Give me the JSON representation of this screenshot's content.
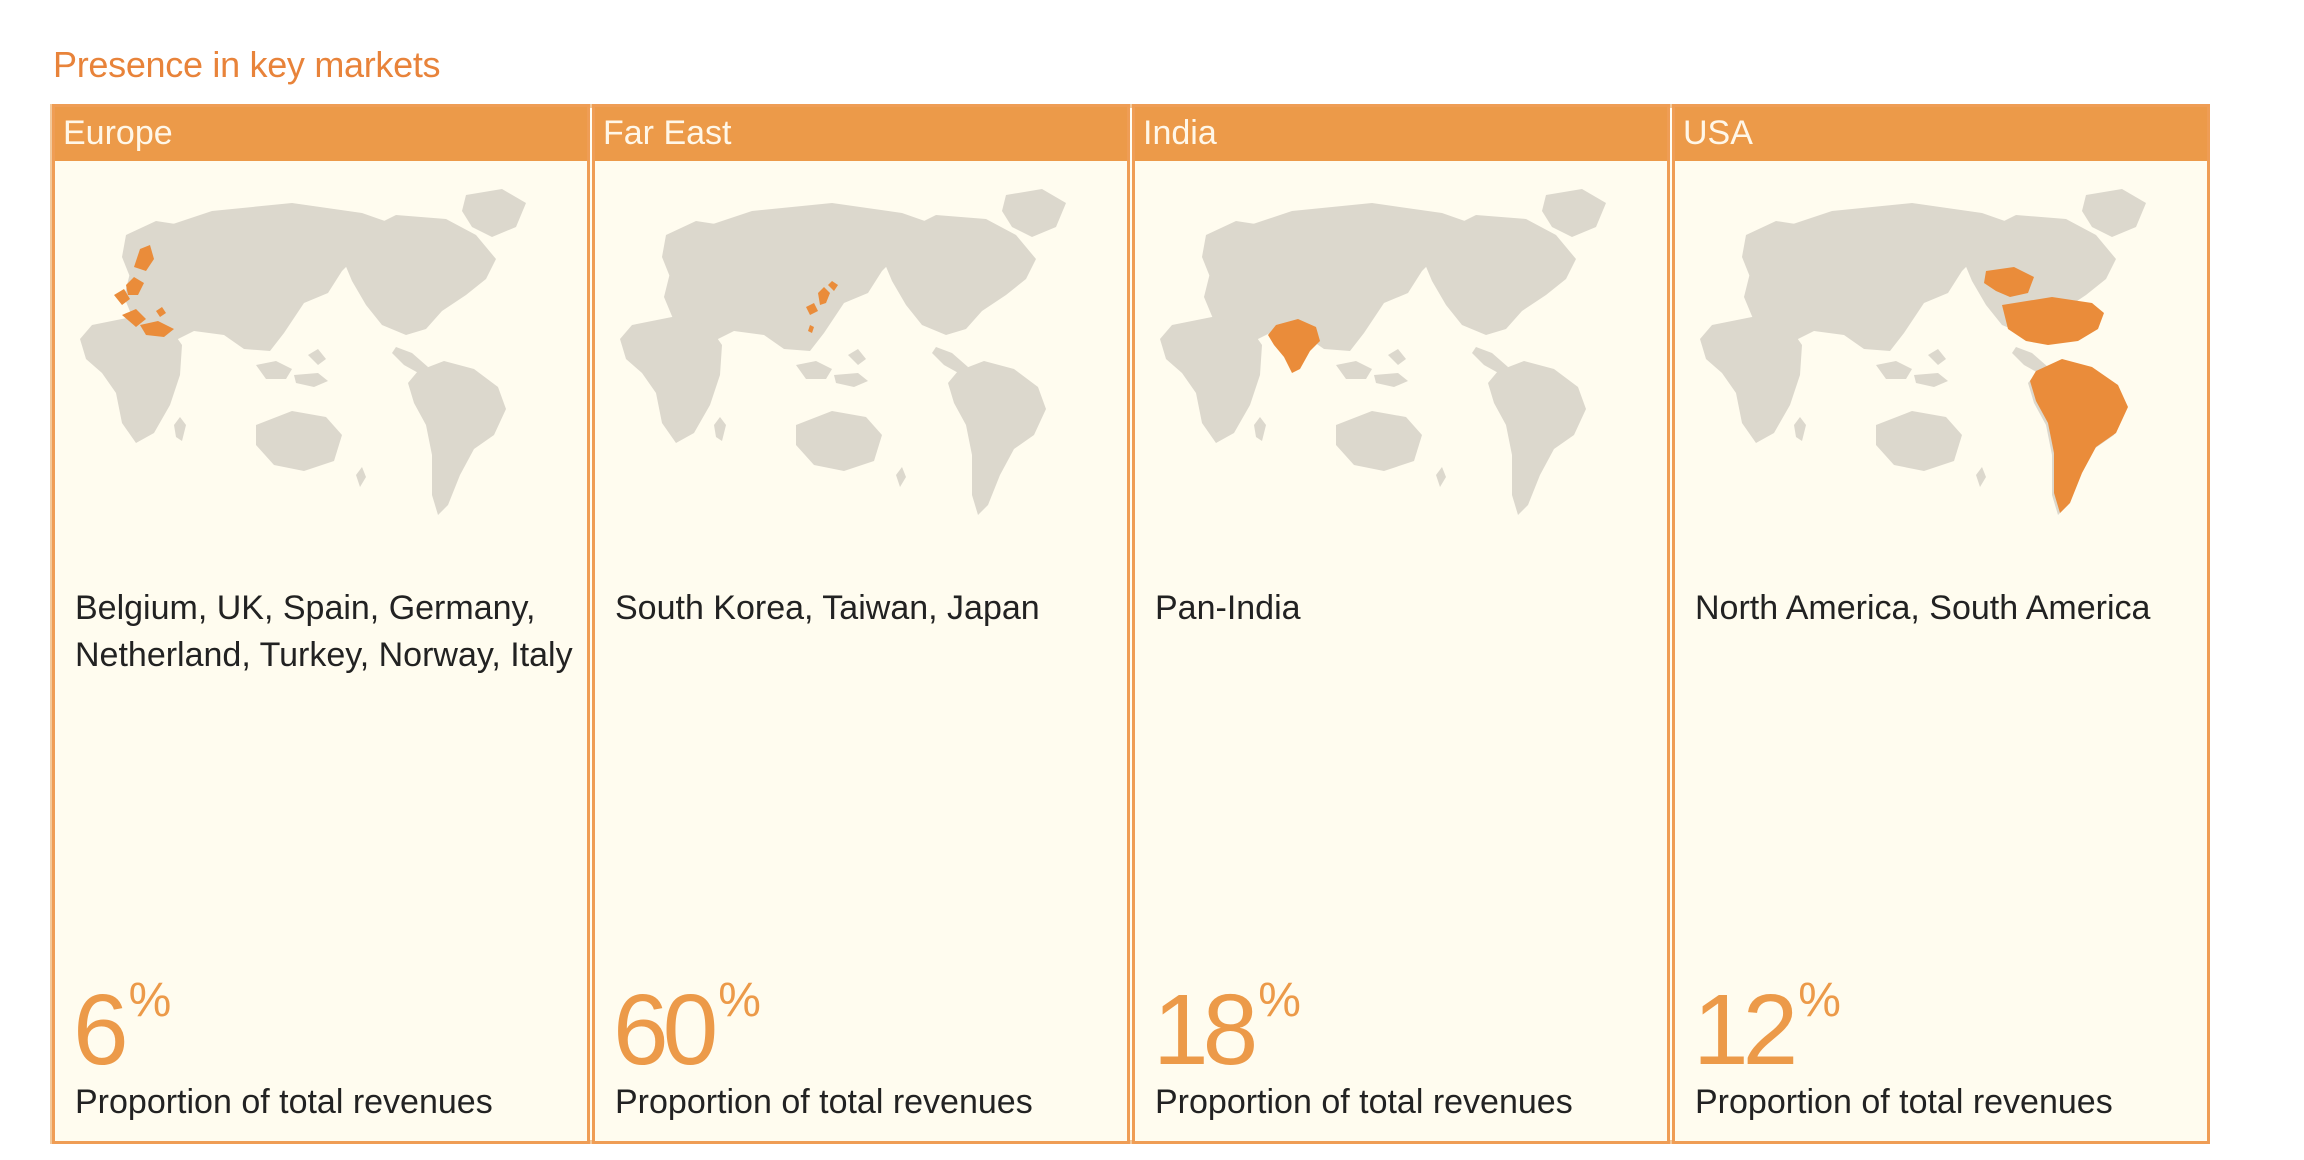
{
  "page": {
    "section_title": "Presence in key markets",
    "accent_color": "#ec9a49",
    "map_land_color": "#dcd8cd",
    "map_highlight_color": "#ea8c3a"
  },
  "panels": [
    {
      "header": "Europe",
      "countries": "Belgium, UK, Spain, Germany, Netherland, Turkey, Norway, Italy",
      "percent": "6",
      "percent_symbol": "%",
      "percent_label": "Proportion of total revenues",
      "highlight_region": "europe"
    },
    {
      "header": "Far East",
      "countries": "South Korea, Taiwan, Japan",
      "percent": "60",
      "percent_symbol": "%",
      "percent_label": "Proportion of total revenues",
      "highlight_region": "far-east"
    },
    {
      "header": "India",
      "countries": "Pan-India",
      "percent": "18",
      "percent_symbol": "%",
      "percent_label": "Proportion of total revenues",
      "highlight_region": "india"
    },
    {
      "header": "USA",
      "countries": "North America, South America",
      "percent": "12",
      "percent_symbol": "%",
      "percent_label": "Proportion of total revenues",
      "highlight_region": "americas"
    }
  ]
}
